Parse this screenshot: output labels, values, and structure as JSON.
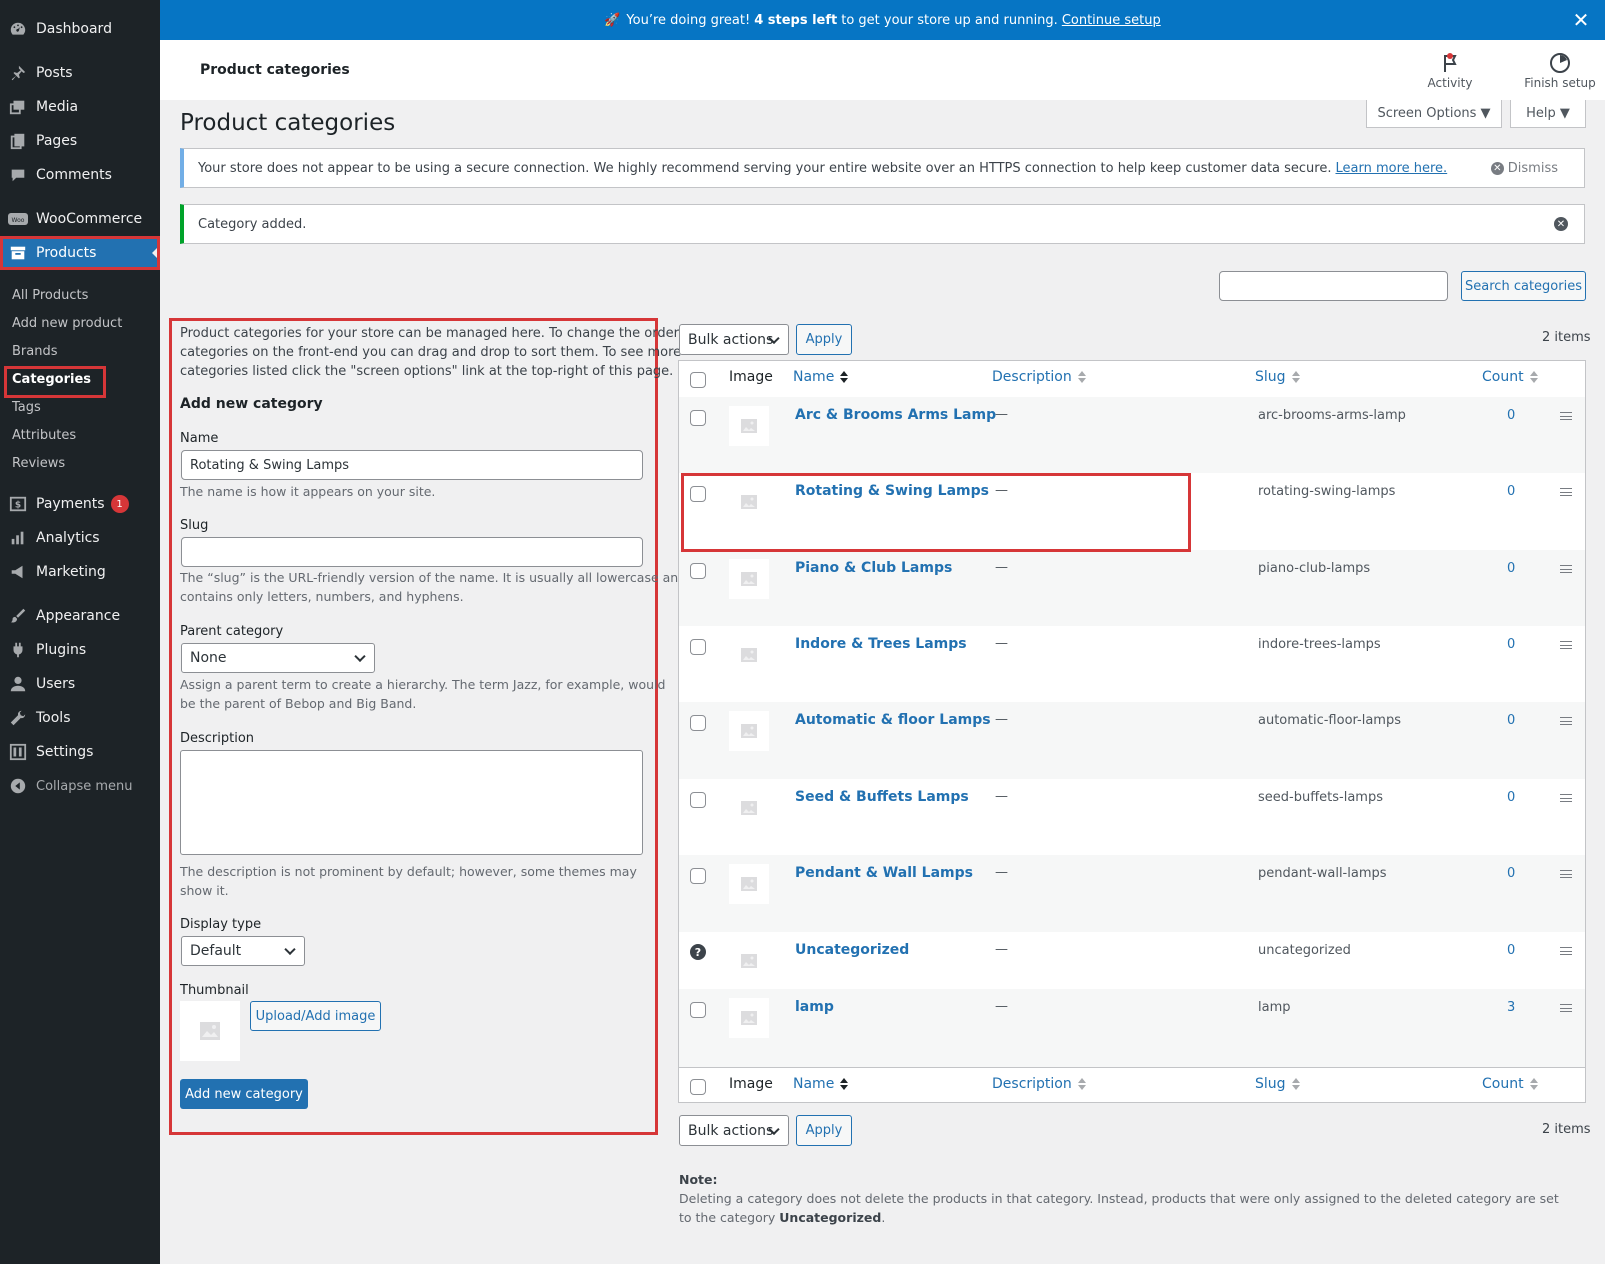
{
  "sidebar": {
    "items": [
      {
        "label": "Dashboard",
        "icon": "dashboard-icon"
      },
      {
        "label": "Posts",
        "icon": "pin-icon"
      },
      {
        "label": "Media",
        "icon": "media-icon"
      },
      {
        "label": "Pages",
        "icon": "pages-icon"
      },
      {
        "label": "Comments",
        "icon": "comments-icon"
      },
      {
        "label": "WooCommerce",
        "icon": "woo-icon"
      },
      {
        "label": "Products",
        "icon": "archive-icon"
      },
      {
        "label": "Payments",
        "icon": "dollar-icon",
        "badge": "1"
      },
      {
        "label": "Analytics",
        "icon": "bar-chart-icon"
      },
      {
        "label": "Marketing",
        "icon": "megaphone-icon"
      },
      {
        "label": "Appearance",
        "icon": "brush-icon"
      },
      {
        "label": "Plugins",
        "icon": "plug-icon"
      },
      {
        "label": "Users",
        "icon": "user-icon"
      },
      {
        "label": "Tools",
        "icon": "wrench-icon"
      },
      {
        "label": "Settings",
        "icon": "settings-icon"
      },
      {
        "label": "Collapse menu",
        "icon": "collapse-icon"
      }
    ],
    "submenu": [
      "All Products",
      "Add new product",
      "Brands",
      "Categories",
      "Tags",
      "Attributes",
      "Reviews"
    ]
  },
  "banner": {
    "emoji": "🚀",
    "text1": "You’re doing great!",
    "bold": "4 steps left",
    "text2": "to get your store up and running.",
    "link": "Continue setup"
  },
  "header": {
    "title": "Product categories",
    "activity": "Activity",
    "finish_setup": "Finish setup"
  },
  "screen_options": "Screen Options ▼",
  "help": "Help ▼",
  "page_title": "Product categories",
  "notices": {
    "https_text": "Your store does not appear to be using a secure connection. We highly recommend serving your entire website over an HTTPS connection to help keep customer data secure.",
    "https_link": "Learn more here.",
    "dismiss": "Dismiss",
    "added": "Category added."
  },
  "search": {
    "button": "Search categories",
    "value": ""
  },
  "form": {
    "intro1": "Product categories for your store can be managed here. To change the order of",
    "intro2": "categories on the front-end you can drag and drop to sort them. To see more",
    "intro3": "categories listed click the \"screen options\" link at the top-right of this page.",
    "heading": "Add new category",
    "name_label": "Name",
    "name_value": "Rotating & Swing Lamps",
    "name_help": "The name is how it appears on your site.",
    "slug_label": "Slug",
    "slug_value": "",
    "slug_help1": "The “slug” is the URL-friendly version of the name. It is usually all lowercase and",
    "slug_help2": "contains only letters, numbers, and hyphens.",
    "parent_label": "Parent category",
    "parent_value": "None",
    "parent_help1": "Assign a parent term to create a hierarchy. The term Jazz, for example, would",
    "parent_help2": "be the parent of Bebop and Big Band.",
    "desc_label": "Description",
    "desc_help1": "The description is not prominent by default; however, some themes may",
    "desc_help2": "show it.",
    "display_label": "Display type",
    "display_value": "Default",
    "thumb_label": "Thumbnail",
    "upload_button": "Upload/Add image",
    "submit": "Add new category"
  },
  "table": {
    "bulk": "Bulk actions",
    "apply": "Apply",
    "items": "2 items",
    "headers": {
      "image": "Image",
      "name": "Name",
      "description": "Description",
      "slug": "Slug",
      "count": "Count"
    },
    "rows": [
      {
        "name": "Arc & Brooms Arms Lamp",
        "desc": "—",
        "slug": "arc-brooms-arms-lamp",
        "count": "0"
      },
      {
        "name": "Rotating & Swing Lamps",
        "desc": "—",
        "slug": "rotating-swing-lamps",
        "count": "0"
      },
      {
        "name": "Piano & Club Lamps",
        "desc": "—",
        "slug": "piano-club-lamps",
        "count": "0"
      },
      {
        "name": "Indore & Trees Lamps",
        "desc": "—",
        "slug": "indore-trees-lamps",
        "count": "0"
      },
      {
        "name": "Automatic & floor Lamps",
        "desc": "—",
        "slug": "automatic-floor-lamps",
        "count": "0"
      },
      {
        "name": "Seed & Buffets Lamps",
        "desc": "—",
        "slug": "seed-buffets-lamps",
        "count": "0"
      },
      {
        "name": "Pendant & Wall Lamps",
        "desc": "—",
        "slug": "pendant-wall-lamps",
        "count": "0"
      },
      {
        "name": "Uncategorized",
        "desc": "—",
        "slug": "uncategorized",
        "count": "0"
      },
      {
        "name": "lamp",
        "desc": "—",
        "slug": "lamp",
        "count": "3"
      }
    ]
  },
  "note": {
    "title": "Note:",
    "text1": "Deleting a category does not delete the products in that category. Instead, products that were only assigned to the deleted category are set to the",
    "text2": "category",
    "bold": "Uncategorized",
    "end": "."
  },
  "colors": {
    "accent": "#2271b1",
    "sidebar": "#1d2327",
    "banner": "#0675c4",
    "highlight": "#d63638"
  }
}
